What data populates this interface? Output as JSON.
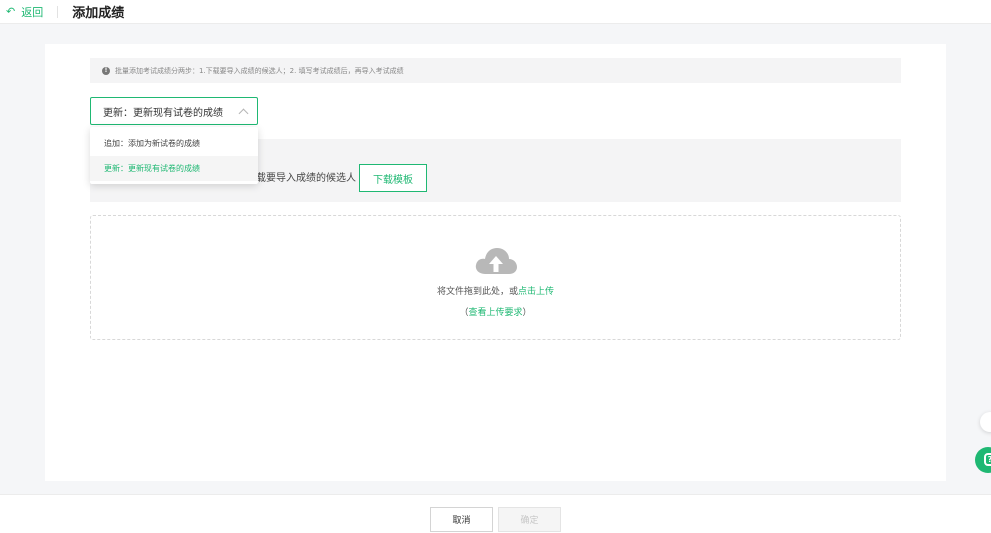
{
  "header": {
    "back_label": "返回",
    "title": "添加成绩"
  },
  "notice": {
    "text": "批量添加考试成绩分两步：1.下载要导入成绩的候选人；2. 填写考试成绩后，再导入考试成绩"
  },
  "mode_select": {
    "value": "更新：更新现有试卷的成绩",
    "options": [
      {
        "label": "追加：添加为新试卷的成绩",
        "selected": false
      },
      {
        "label": "更新：更新现有试卷的成绩",
        "selected": true
      }
    ]
  },
  "step1": {
    "text": "载要导入成绩的候选人",
    "download_label": "下载模板"
  },
  "upload": {
    "prompt": "将文件拖到此处，或",
    "link": "点击上传",
    "paren_open": "（",
    "requirements_link": "查看上传要求",
    "paren_close": "）"
  },
  "footer": {
    "cancel_label": "取消",
    "confirm_label": "确定"
  },
  "icons": {
    "back": "undo-arrow-icon",
    "notice": "info-icon",
    "upload": "cloud-upload-icon",
    "headset": "headset-icon",
    "help": "help-icon"
  },
  "colors": {
    "accent": "#1fb873",
    "page_bg": "#f5f6f8"
  }
}
